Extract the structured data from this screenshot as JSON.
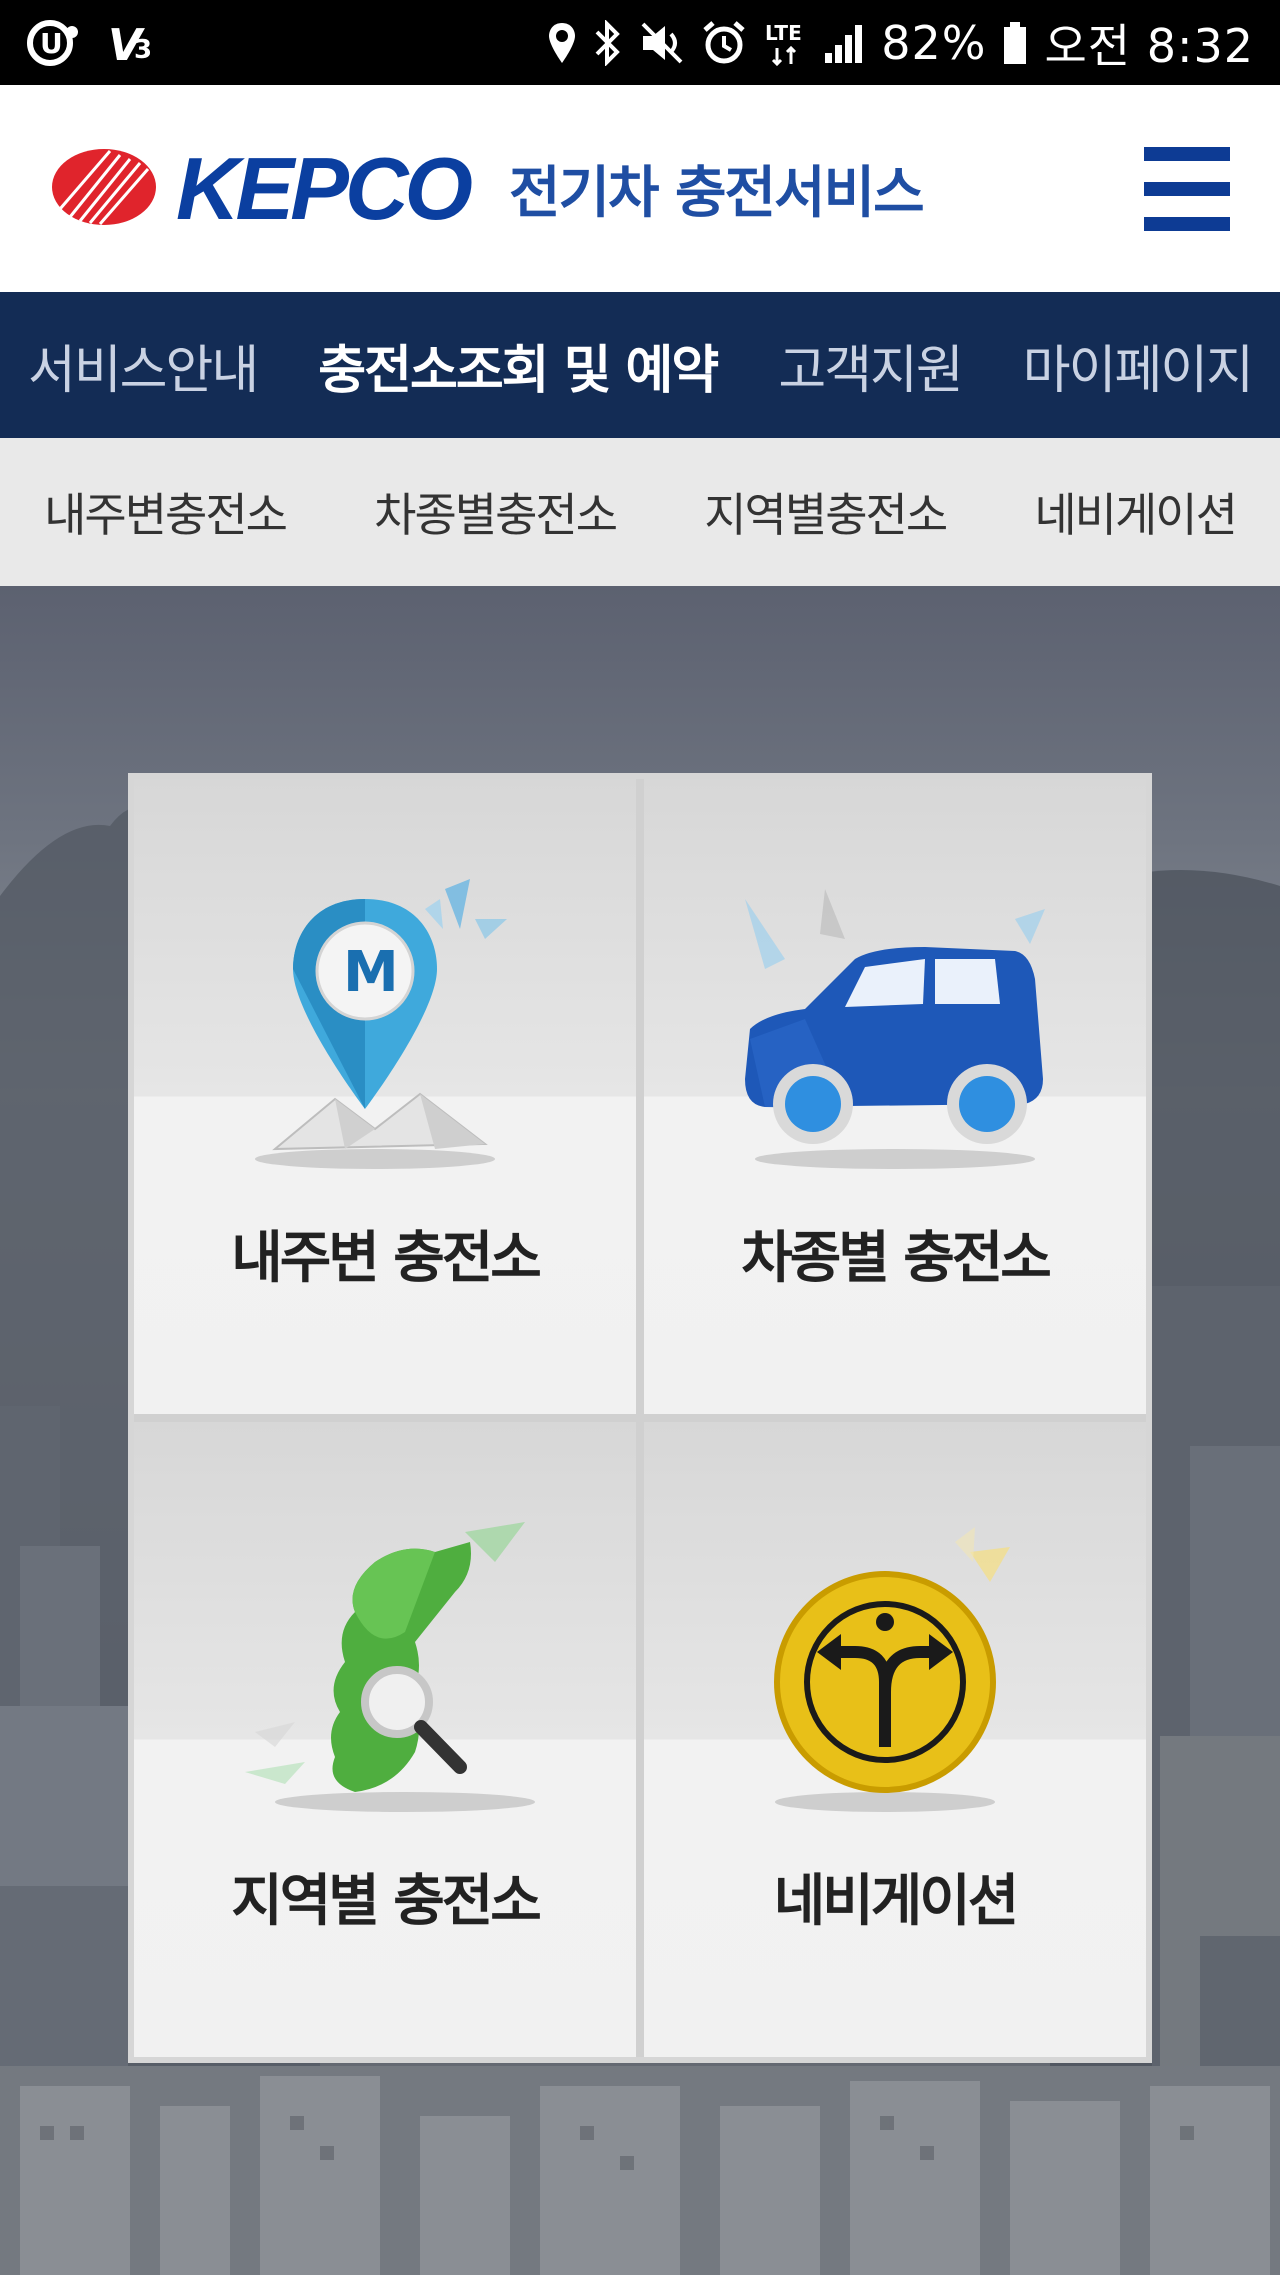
{
  "status_bar": {
    "battery": "82%",
    "time": "오전 8:32",
    "network": "LTE"
  },
  "header": {
    "brand_word": "KEPCO",
    "service_title": "전기차 충전서비스"
  },
  "main_nav": {
    "items": [
      {
        "label": "서비스안내"
      },
      {
        "label": "충전소조회 및 예약"
      },
      {
        "label": "고객지원"
      },
      {
        "label": "마이페이지"
      }
    ]
  },
  "sub_nav": {
    "items": [
      {
        "label": "내주변충전소"
      },
      {
        "label": "차종별충전소"
      },
      {
        "label": "지역별충전소"
      },
      {
        "label": "네비게이션"
      }
    ]
  },
  "tiles": [
    {
      "label": "내주변 충전소",
      "icon": "map-pin-icon"
    },
    {
      "label": "차종별 충전소",
      "icon": "car-icon"
    },
    {
      "label": "지역별 충전소",
      "icon": "korea-map-icon"
    },
    {
      "label": "네비게이션",
      "icon": "navigation-icon"
    }
  ],
  "colors": {
    "nav_bg": "#132c55",
    "brand_blue": "#0b3fa0",
    "brand_red": "#e0242c"
  }
}
